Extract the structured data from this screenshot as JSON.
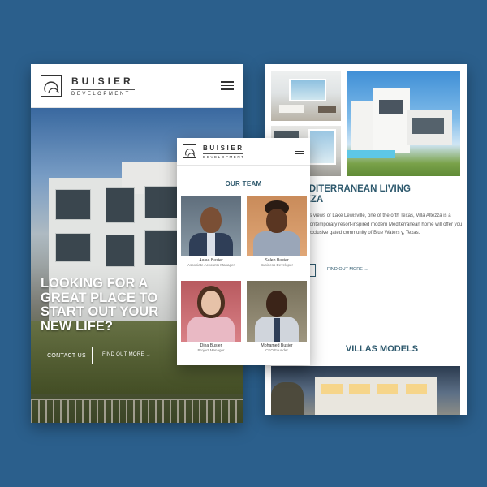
{
  "brand": {
    "name": "BUISIER",
    "tagline": "DEVELOPMENT"
  },
  "hero": {
    "title": "LOOKING FOR A GREAT PLACE TO START OUT YOUR NEW LIFE?",
    "contact_label": "CONTACT US",
    "more_label": "FIND OUT MORE →"
  },
  "team": {
    "title": "OUR TEAM",
    "members": [
      {
        "name": "Aalaa Busier",
        "role": "Associate Accounts Manager"
      },
      {
        "name": "Saleh Busier",
        "role": "Business Developer"
      },
      {
        "name": "Dina Busier",
        "role": "Project Manager"
      },
      {
        "name": "Mohamed Busier",
        "role": "CEO/Founder"
      }
    ]
  },
  "villa": {
    "heading_line1": "NCE MEDITERRANEAN LIVING",
    "heading_line2": "A ALTEZZA",
    "paragraph": "f a hill with endless views of Lake Lewisville, one of the orth Texas, Villa Altezza is a timeless work of contemporary resort-inspired modern Mediterranean home will offer you and luxury in the exclusive gated community of Blue Waters y, Texas.",
    "more_label": "FIND OUT MORE →",
    "models_heading": "VILLAS MODELS"
  },
  "colors": {
    "background": "#2b5f8c",
    "accent": "#2f5a6e"
  }
}
